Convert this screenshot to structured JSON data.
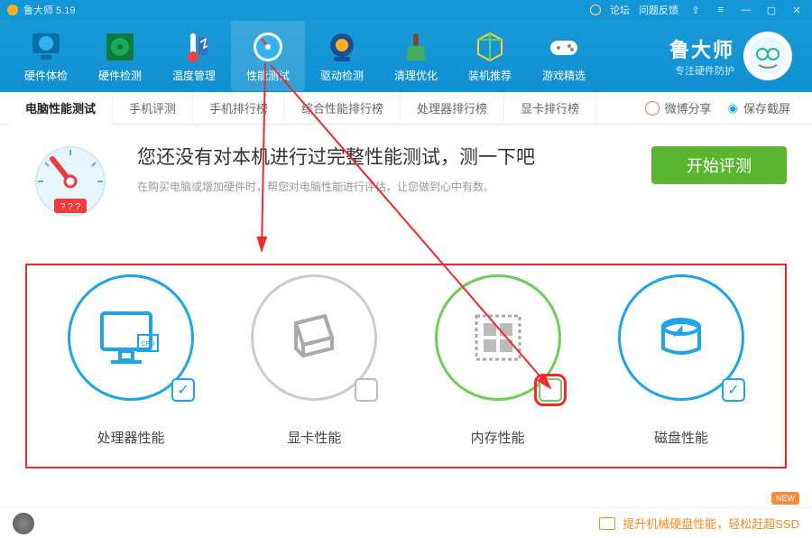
{
  "titlebar": {
    "app_name": "鲁大师 5.19",
    "forum": "论坛",
    "feedback": "问题反馈"
  },
  "nav": [
    {
      "label": "硬件体检"
    },
    {
      "label": "硬件检测"
    },
    {
      "label": "温度管理"
    },
    {
      "label": "性能测试"
    },
    {
      "label": "驱动检测"
    },
    {
      "label": "清理优化"
    },
    {
      "label": "装机推荐"
    },
    {
      "label": "游戏精选"
    }
  ],
  "brand": {
    "main": "鲁大师",
    "sub": "专注硬件防护"
  },
  "subtabs": [
    "电脑性能测试",
    "手机评测",
    "手机排行榜",
    "综合性能排行榜",
    "处理器排行榜",
    "显卡排行榜"
  ],
  "subtabs_right": {
    "weibo": "微博分享",
    "screenshot": "保存截屏"
  },
  "hero": {
    "title": "您还没有对本机进行过完整性能测试，测一下吧",
    "sub": "在购买电脑或增加硬件时，帮您对电脑性能进行评估，让您做到心中有数。",
    "gauge_label": "? ? ?"
  },
  "start_btn": "开始评测",
  "tests": [
    {
      "label": "处理器性能",
      "checked": true,
      "color": "blue"
    },
    {
      "label": "显卡性能",
      "checked": false,
      "color": "gray"
    },
    {
      "label": "内存性能",
      "checked": false,
      "color": "green",
      "highlight": true
    },
    {
      "label": "磁盘性能",
      "checked": true,
      "color": "blue"
    }
  ],
  "bottom": {
    "tip": "提升机械硬盘性能，轻松赶超SSD",
    "new": "NEW"
  }
}
